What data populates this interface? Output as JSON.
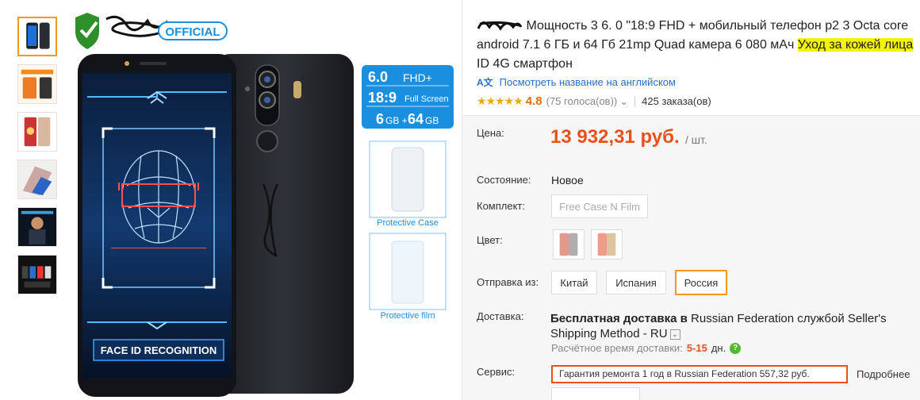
{
  "gallery": {
    "thumbnails": [
      "thumb-1",
      "thumb-2",
      "thumb-3",
      "thumb-4",
      "thumb-5",
      "thumb-6"
    ],
    "badge_text": "OFFICIAL",
    "spec_line1_big": "6.0",
    "spec_line1_small": "FHD+",
    "spec_line2_big": "18:9",
    "spec_line2_small": "Full Screen",
    "spec_line3_a": "6",
    "spec_line3_b": "GB +",
    "spec_line3_c": "64",
    "spec_line3_d": "GB",
    "accessory_case_label": "Protective Case",
    "accessory_film_label": "Protective film",
    "face_banner": "FACE ID RECOGNITION"
  },
  "product": {
    "title_part1": " Мощность 3 6. 0 \"18:9 FHD + мобильный телефон p2 3 Octa core android 7.1 6 ГБ и 64 Гб 21mp Quad камера 6 080 мАч ",
    "title_highlight": "Уход за кожей лица",
    "title_part2": " ID 4G смартфон",
    "translate_link": "Посмотреть название на английском",
    "translate_icon": "A文",
    "stars": "★★★★★",
    "rating": "4.8",
    "votes": "(75 голоса(ов))",
    "votes_arrow": "⌄",
    "orders": "425 заказа(ов)"
  },
  "price": {
    "label": "Цена:",
    "value": "13 932,31 руб.",
    "unit": "/ шт."
  },
  "options": {
    "condition_label": "Состояние:",
    "condition_value": "Новое",
    "kit_label": "Комплект:",
    "kit_option": "Free Case N Film",
    "color_label": "Цвет:",
    "ship_from_label": "Отправка из:",
    "ship_from_options": [
      "Китай",
      "Испания",
      "Россия"
    ],
    "ship_from_selected": "Россия"
  },
  "delivery": {
    "label": "Доставка:",
    "text_bold": "Бесплатная доставка в",
    "text_rest": " Russian Federation службой Seller's Shipping Method - RU",
    "dropdown_glyph": "⌄",
    "estimate_label": "Расчётное время доставки:",
    "estimate_days": "5-15",
    "estimate_unit": "дн.",
    "help_glyph": "?"
  },
  "service": {
    "label": "Сервис:",
    "value": "Гарантия ремонта 1 год в Russian Federation 557,32 руб.",
    "more_link": "Подробнее"
  },
  "colors": {
    "accent_orange": "#f29b1b",
    "price_red": "#e8521a",
    "link_blue": "#2a6fc9",
    "highlight_yellow": "#f4f400",
    "spec_blue": "#1a8fe0"
  }
}
